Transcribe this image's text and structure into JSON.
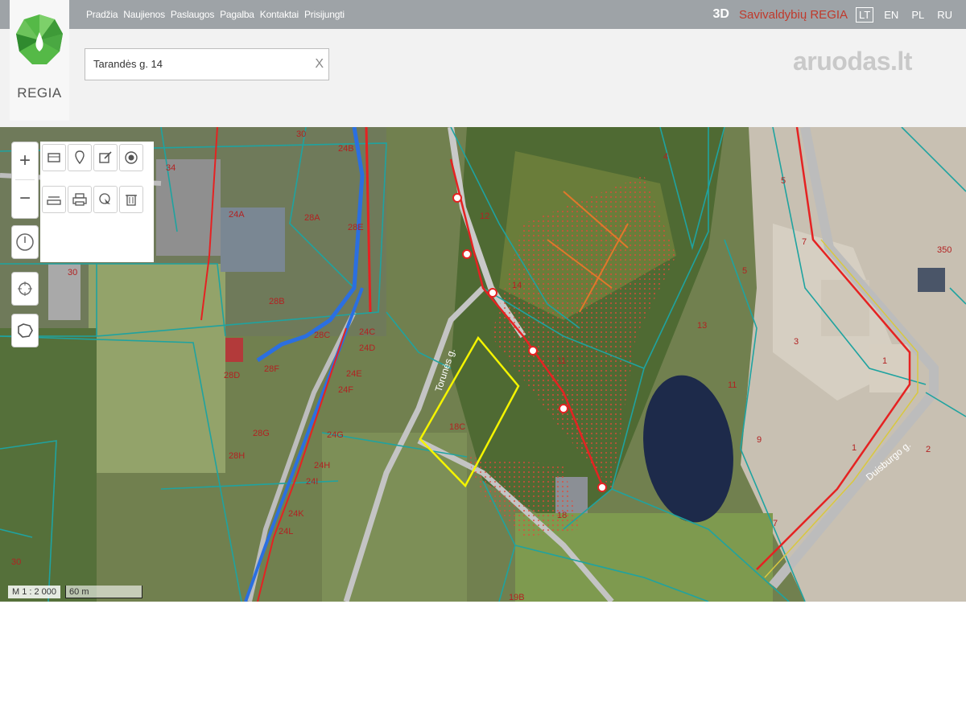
{
  "nav": {
    "items": [
      "Pradžia",
      "Naujienos",
      "Paslaugos",
      "Pagalba",
      "Kontaktai",
      "Prisijungti"
    ],
    "btn_3d": "3D",
    "brand": "Savivaldybių REGIA",
    "languages": [
      "LT",
      "EN",
      "PL",
      "RU"
    ],
    "active_language": "LT"
  },
  "logo": {
    "text": "REGIA"
  },
  "search": {
    "value": "Tarandės g. 14",
    "clear": "X"
  },
  "watermark": "aruodas.lt",
  "map": {
    "street_labels": [
      "Torunės g.",
      "Duisburgo g."
    ],
    "selected_parcel": "18C",
    "parcel_labels": [
      "34",
      "30",
      "30",
      "28A",
      "28B",
      "28C",
      "28D",
      "28E",
      "28F",
      "28G",
      "28H",
      "24A",
      "24B",
      "24C",
      "24D",
      "24E",
      "24F",
      "24G",
      "24H",
      "24I",
      "24K",
      "24L",
      "12",
      "14",
      "11",
      "18",
      "19B",
      "4",
      "5",
      "5",
      "7",
      "7",
      "350",
      "3",
      "1",
      "13",
      "9",
      "11",
      "2",
      "1",
      "30"
    ],
    "scale_text": "M 1 : 2 000",
    "scale_bar": "60 m"
  },
  "colors": {
    "topbar": "#9ea3a7",
    "brand": "#c0392b",
    "parcel_line": "#1fa3a0",
    "selected": "#f4f400",
    "utility_red": "#e52222",
    "utility_blue": "#2b6fe0",
    "hatch": "#d94a3a"
  }
}
